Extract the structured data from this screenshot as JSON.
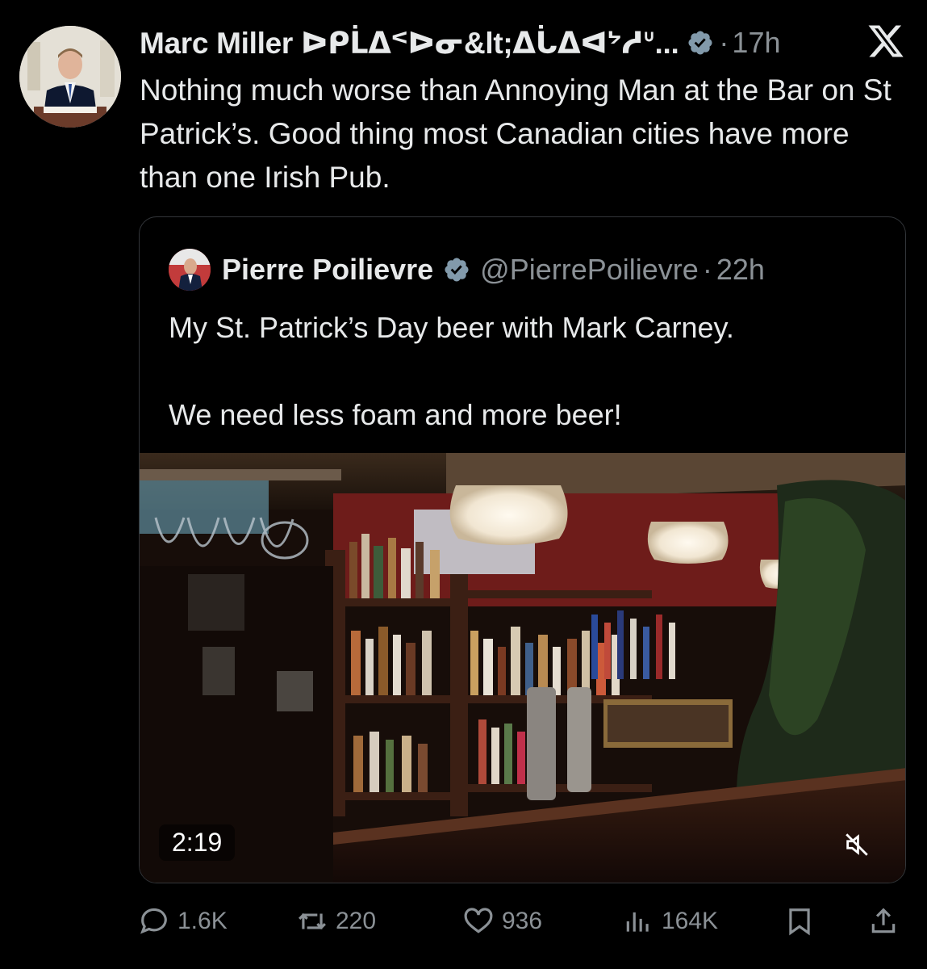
{
  "tweet": {
    "author_name": "Marc Miller ᐅᑭᒫᐃᑉᐅᓂ&lt;ᐃᒑᐃᐊᔾᓱᐡ...",
    "dot": "·",
    "time": "17h",
    "text": "Nothing much worse than Annoying Man at the Bar on St Patrick’s. Good thing most Canadian cities have more than one Irish Pub."
  },
  "quoted": {
    "author_name": "Pierre Poilievre",
    "handle": "@PierrePoilievre",
    "dot": "·",
    "time": "22h",
    "text_line1": "My St. Patrick’s Day beer with Mark Carney.",
    "text_line2": "We need less foam and more beer!",
    "video_duration": "2:19"
  },
  "actions": {
    "replies": "1.6K",
    "reposts": "220",
    "likes": "936",
    "views": "164K"
  },
  "colors": {
    "background": "#000000",
    "text": "#e7e9ea",
    "muted": "#8b9196",
    "verified": "#829aab",
    "border": "#33363a"
  },
  "icons": [
    "x-logo-icon",
    "verified-icon",
    "reply-icon",
    "repost-icon",
    "like-icon",
    "views-icon",
    "bookmark-icon",
    "share-icon",
    "mute-icon"
  ]
}
